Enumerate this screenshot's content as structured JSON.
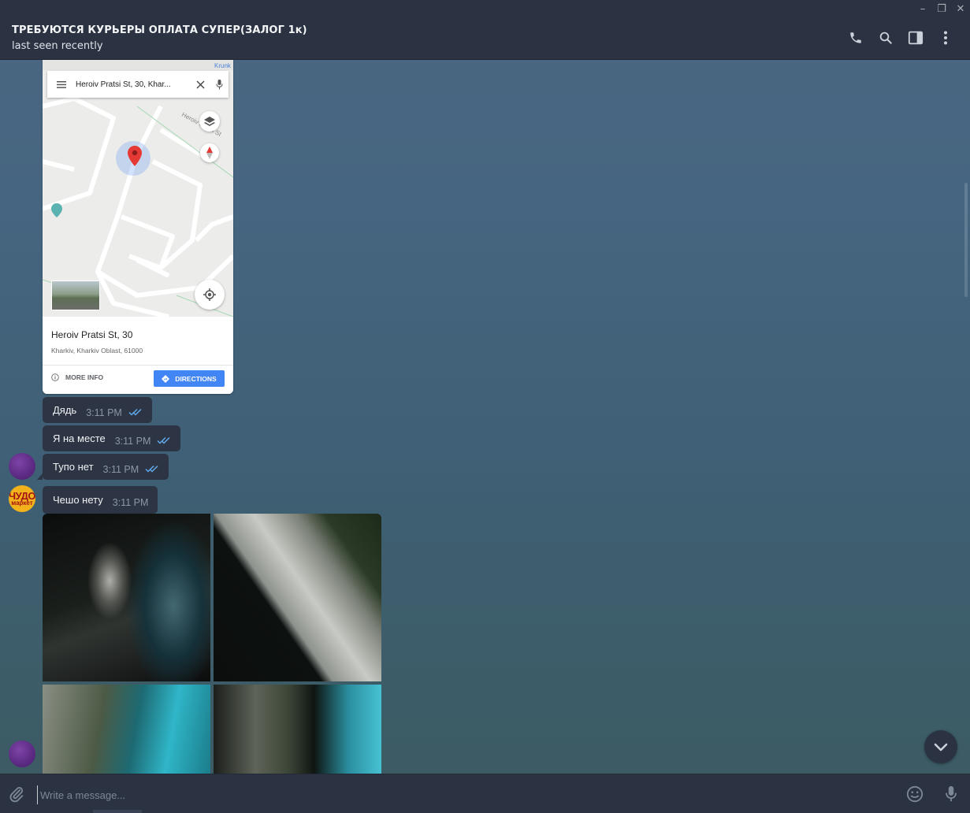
{
  "window": {
    "minimize_label": "–",
    "maximize_label": "❐",
    "close_label": "✕"
  },
  "header": {
    "title": "ТРЕБУЮТСЯ КУРЬЕРЫ ОПЛАТА СУПЕР(ЗАЛОГ 1к)",
    "status": "last seen recently",
    "actions": [
      "phone-icon",
      "search-icon",
      "sidebar-toggle-icon",
      "more-vert-icon"
    ]
  },
  "map_message": {
    "search_query": "Heroiv Pratsi St, 30, Khar...",
    "place_name": "Heroiv Pratsi St, 30",
    "place_address": "Kharkiv, Kharkiv Oblast, 61000",
    "more_info_label": "MORE INFO",
    "directions_label": "DIRECTIONS",
    "street_label": "Heroiv Pratsi St",
    "corner_label": "Krunk"
  },
  "messages": [
    {
      "text": "Дядь",
      "time": "3:11 PM",
      "read": true
    },
    {
      "text": "Я на месте",
      "time": "3:11 PM",
      "read": true
    },
    {
      "text": "Тупо нет",
      "time": "3:11 PM",
      "read": true
    },
    {
      "text": "Чешо нету",
      "time": "3:11 PM",
      "read": false
    }
  ],
  "avatars": {
    "shop_line1": "ЧУДО",
    "shop_line2": "маркет"
  },
  "composer": {
    "placeholder": "Write a message..."
  },
  "colors": {
    "header_bg": "#2b3342",
    "bubble_bg": "#2d3544",
    "read_ticks": "#5fa8ec",
    "directions_button": "#4285f4"
  }
}
